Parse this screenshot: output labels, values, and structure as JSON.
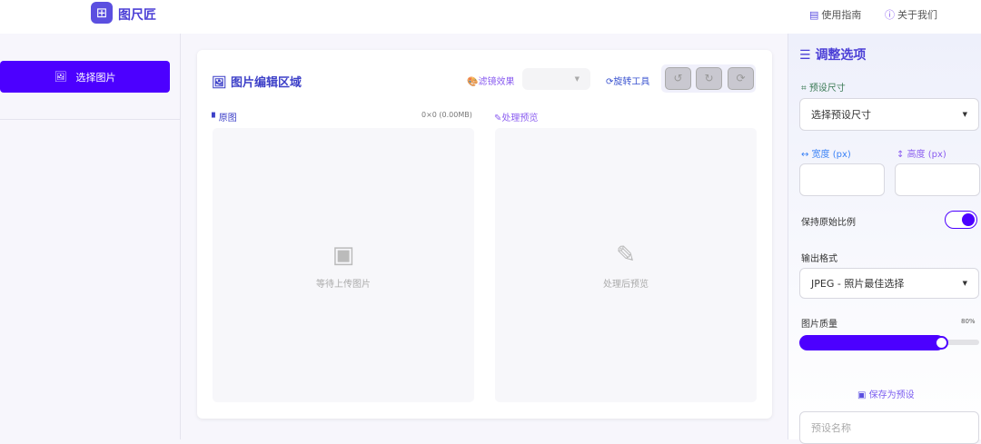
{
  "header": {
    "logo_glyph": "⊞",
    "brand": "图尺匠",
    "nav": [
      {
        "icon": "book-icon",
        "label": "使用指南"
      },
      {
        "icon": "info-icon",
        "label": "关于我们"
      }
    ]
  },
  "sidebar": {
    "select_label": "选择图片"
  },
  "editor": {
    "title": "图片编辑区域",
    "filter_label": "滤镜效果",
    "filter_value": "",
    "rotate_label": "旋转工具",
    "rotate_buttons": [
      "↺",
      "↻",
      "⟳"
    ],
    "original_label": "原图",
    "original_info": "0×0 (0.00MB)",
    "preview_label": "处理预览",
    "original_placeholder": "等待上传图片",
    "preview_placeholder": "处理后预览"
  },
  "options": {
    "title": "调整选项",
    "preset_size_label": "预设尺寸",
    "preset_size_value": "选择预设尺寸",
    "width_label": "宽度 (px)",
    "height_label": "高度 (px)",
    "width_value": "",
    "height_value": "",
    "keep_ratio_label": "保持原始比例",
    "keep_ratio": true,
    "format_label": "输出格式",
    "format_value": "JPEG - 照片最佳选择",
    "quality_label": "图片质量",
    "quality_text": "80%",
    "quality": 80,
    "save_preset_label": "保存为预设",
    "preset_name_placeholder": "预设名称"
  },
  "colors": {
    "accent": "#4c00ff",
    "title": "#3d40c8"
  }
}
